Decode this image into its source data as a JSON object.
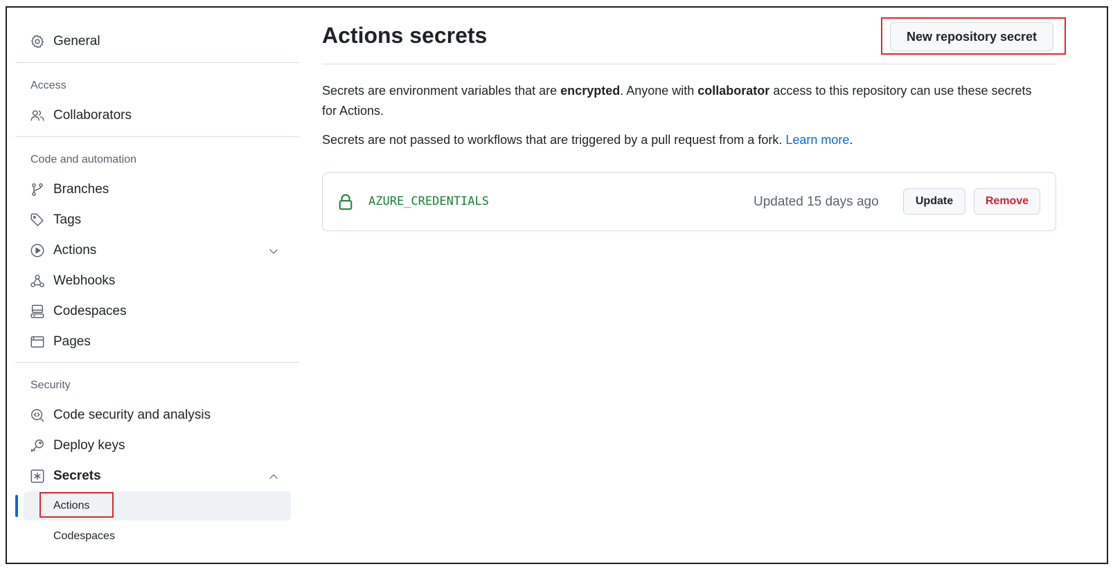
{
  "sidebar": {
    "general": "General",
    "sections": {
      "access": "Access",
      "code_automation": "Code and automation",
      "security": "Security"
    },
    "items": {
      "collaborators": "Collaborators",
      "branches": "Branches",
      "tags": "Tags",
      "actions": "Actions",
      "webhooks": "Webhooks",
      "codespaces": "Codespaces",
      "pages": "Pages",
      "code_security": "Code security and analysis",
      "deploy_keys": "Deploy keys",
      "secrets": "Secrets"
    },
    "secrets_sub": {
      "actions": "Actions",
      "codespaces": "Codespaces"
    }
  },
  "main": {
    "title": "Actions secrets",
    "new_button": "New repository secret",
    "desc1_a": "Secrets are environment variables that are ",
    "desc1_b": "encrypted",
    "desc1_c": ". Anyone with ",
    "desc1_d": "collaborator",
    "desc1_e": " access to this repository can use these secrets for Actions.",
    "desc2_a": "Secrets are not passed to workflows that are triggered by a pull request from a fork. ",
    "desc2_link": "Learn more",
    "desc2_end": ".",
    "secret": {
      "name": "AZURE_CREDENTIALS",
      "updated": "Updated 15 days ago",
      "update_label": "Update",
      "remove_label": "Remove"
    }
  },
  "colors": {
    "accent": "#0969da",
    "highlight": "#e0262d",
    "secret_name": "#1a7f37",
    "danger": "#cf222e"
  }
}
